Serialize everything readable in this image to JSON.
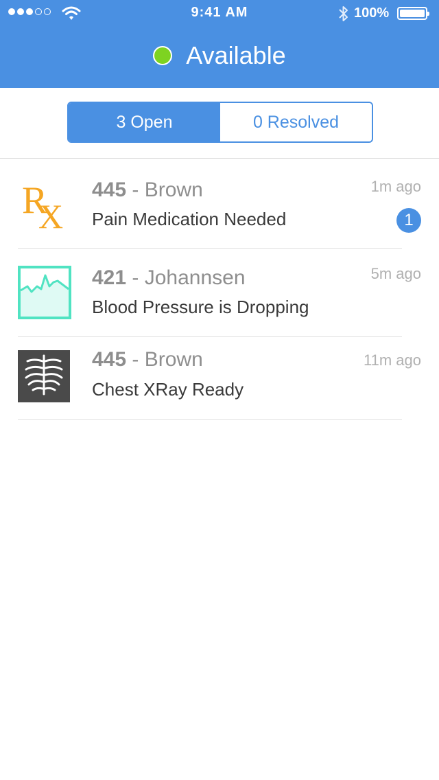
{
  "status_bar": {
    "time": "9:41 AM",
    "battery_percent": "100%",
    "signal_bars_filled": 3,
    "signal_bars_total": 5,
    "battery_level": 1.0
  },
  "header": {
    "title": "Available",
    "status_color": "#7ed321",
    "background_color": "#4a90e2"
  },
  "segments": [
    {
      "label": "3 Open",
      "active": true
    },
    {
      "label": "0 Resolved",
      "active": false
    }
  ],
  "alerts": [
    {
      "room": "445",
      "name": " - Brown",
      "message": "Pain Medication Needed",
      "time_ago": "1m ago",
      "badge": "1",
      "icon": "rx-icon",
      "icon_color": "#f5a623"
    },
    {
      "room": "421",
      "name": " - Johannsen",
      "message": "Blood Pressure is Dropping",
      "time_ago": "5m ago",
      "badge": "",
      "icon": "vitals-monitor-icon",
      "icon_color": "#50e3c2"
    },
    {
      "room": "445",
      "name": " - Brown",
      "message": "Chest XRay Ready",
      "time_ago": "11m ago",
      "badge": "",
      "icon": "xray-chest-icon",
      "icon_color": "#4a4a4a"
    }
  ]
}
